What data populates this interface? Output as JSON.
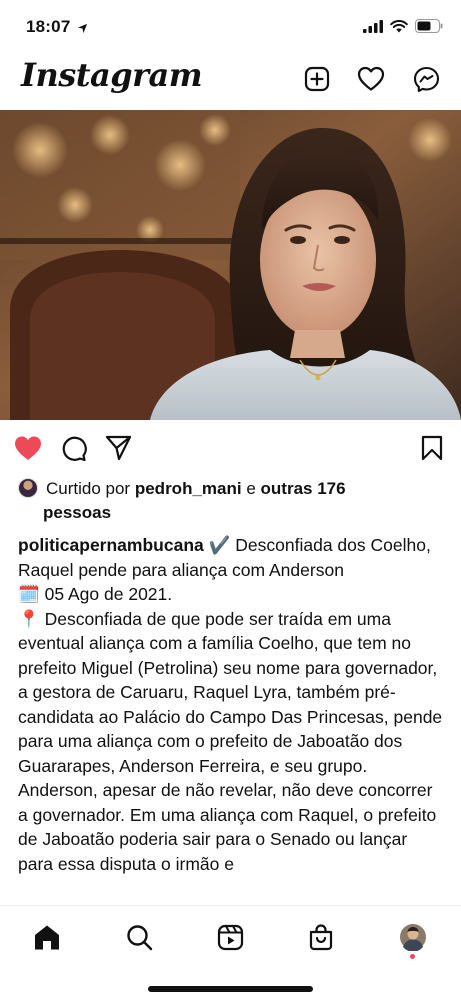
{
  "status_bar": {
    "time": "18:07",
    "icons": [
      "location-arrow-icon",
      "cellular-signal-icon",
      "wifi-icon",
      "battery-icon"
    ]
  },
  "header": {
    "logo": "Instagram",
    "icons": [
      "new-post-icon",
      "heart-icon",
      "messenger-icon"
    ]
  },
  "post": {
    "liked": true,
    "accent_like_color": "#ed4956",
    "likes": {
      "prefix": "Curtido por",
      "user": "pedroh_mani",
      "connector": "e",
      "others": "outras 176",
      "others_tail": "pessoas"
    },
    "caption": {
      "username": "politicapernambucana",
      "title": "✔️ Desconfiada dos Coelho, Raquel pende para aliança com Anderson",
      "date_line": "🗓️ 05 Ago de 2021.",
      "paragraph1": "📍 Desconfiada de que pode ser traída em uma eventual aliança com a família Coelho, que tem no prefeito Miguel (Petrolina) seu nome para governador, a gestora de Caruaru, Raquel Lyra, também pré-candidata ao Palácio do Campo Das Princesas, pende para uma aliança com o prefeito de Jaboatão dos Guararapes, Anderson Ferreira, e seu grupo.",
      "paragraph2": "Anderson, apesar de não revelar, não deve concorrer a governador. Em uma aliança com Raquel, o prefeito de Jaboatão poderia sair para o Senado ou lançar para essa disputa o irmão e"
    }
  },
  "tab_bar": {
    "tabs": [
      "home-icon",
      "search-icon",
      "reels-icon",
      "shop-icon",
      "profile-avatar"
    ]
  }
}
